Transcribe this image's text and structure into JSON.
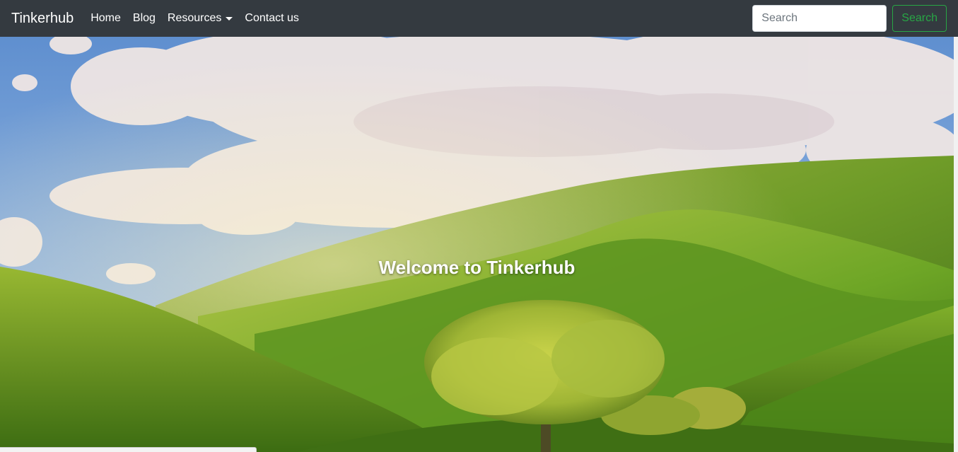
{
  "navbar": {
    "brand": "Tinkerhub",
    "links": [
      "Home",
      "Blog",
      "Resources",
      "Contact us"
    ],
    "search": {
      "placeholder": "Search",
      "button_label": "Search"
    }
  },
  "hero": {
    "title": "Welcome to Tinkerhub"
  },
  "colors": {
    "navbar_bg": "#343a40",
    "search_button": "#28a745",
    "sky": "#6f9bd6",
    "hills": "#5f9a1d"
  }
}
